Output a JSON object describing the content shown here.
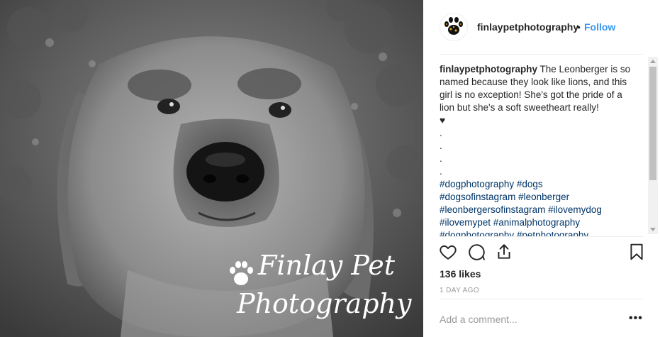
{
  "post": {
    "image_alt": "Black and white portrait of a Leonberger dog",
    "watermark_line1": "Finlay Pet",
    "watermark_line2": "Photography"
  },
  "header": {
    "username": "finlaypetphotography",
    "separator": "•",
    "follow_label": "Follow",
    "avatar_icon": "paw-print-logo-icon"
  },
  "caption": {
    "username": "finlaypetphotography",
    "text": "The Leonberger is so named because they look like lions, and this girl is no exception! She's got the pride of a lion but she's a soft sweetheart really!",
    "heart": "♥",
    "dots": [
      ".",
      ".",
      ".",
      "."
    ],
    "hashtag_lines": [
      "#dogphotography #dogs",
      "#dogsofinstagram #leonberger",
      "#leonbergersofinstagram #ilovemydog",
      "#ilovemypet #animalphotography",
      "#dogphotography #petphotography"
    ]
  },
  "actions": {
    "like_icon": "heart-icon",
    "comment_icon": "comment-bubble-icon",
    "share_icon": "share-icon",
    "save_icon": "bookmark-icon"
  },
  "likes_label": "136 likes",
  "timestamp": "1 DAY AGO",
  "comment": {
    "placeholder": "Add a comment...",
    "more_label": "•••"
  },
  "colors": {
    "link_blue": "#3897f0",
    "hashtag_blue": "#003569",
    "muted": "#999999",
    "text": "#262626"
  }
}
